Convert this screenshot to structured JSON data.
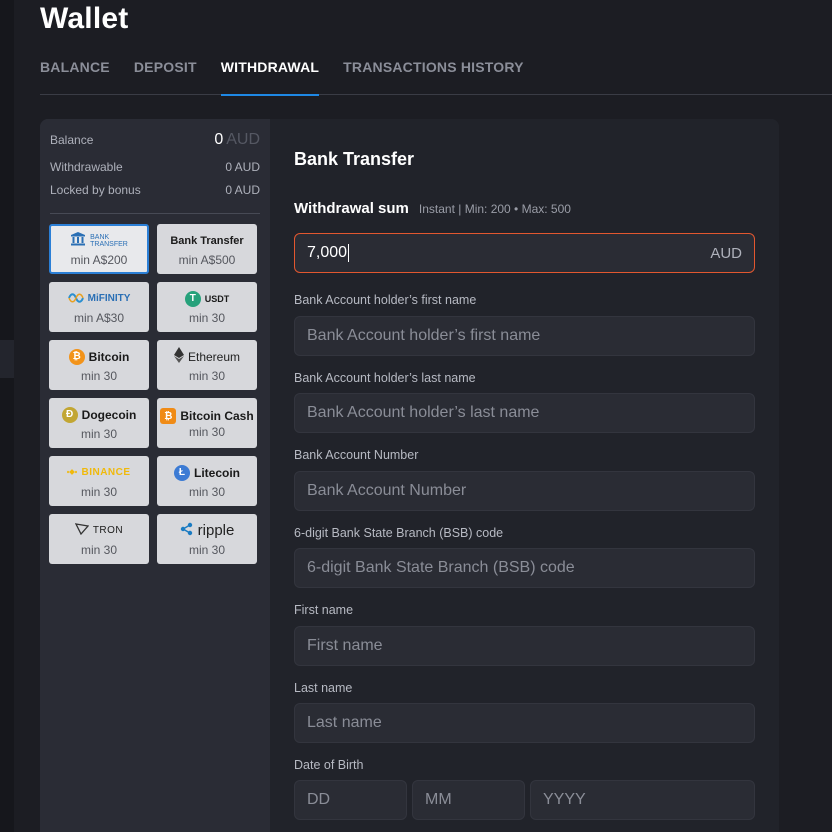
{
  "page": {
    "title": "Wallet"
  },
  "tabs": [
    {
      "label": "BALANCE"
    },
    {
      "label": "DEPOSIT"
    },
    {
      "label": "WITHDRAWAL",
      "active": true
    },
    {
      "label": "TRANSACTIONS HISTORY"
    }
  ],
  "balance": {
    "balance_label": "Balance",
    "balance_value": "0",
    "balance_currency": "AUD",
    "withdrawable_label": "Withdrawable",
    "withdrawable_value": "0 AUD",
    "locked_label": "Locked by bonus",
    "locked_value": "0 AUD"
  },
  "methods": [
    {
      "logo_top": "BANK",
      "logo_bottom": "TRANSFER",
      "min": "min A$200",
      "icon": "bank-icon"
    },
    {
      "logo": "Bank Transfer",
      "min": "min A$500"
    },
    {
      "logo": "MiFINITY",
      "min": "min A$30",
      "icon": "mifinity-icon"
    },
    {
      "logo": "USDT",
      "min": "min 30",
      "icon": "tether-icon"
    },
    {
      "logo": "Bitcoin",
      "min": "min 30",
      "icon": "bitcoin-icon"
    },
    {
      "logo": "Ethereum",
      "min": "min 30",
      "icon": "ethereum-icon"
    },
    {
      "logo": "Dogecoin",
      "min": "min 30",
      "icon": "dogecoin-icon"
    },
    {
      "logo": "Bitcoin Cash",
      "min": "min 30",
      "icon": "bitcoin-cash-icon"
    },
    {
      "logo": "BINANCE",
      "min": "min 30",
      "icon": "binance-icon"
    },
    {
      "logo": "Litecoin",
      "min": "min 30",
      "icon": "litecoin-icon"
    },
    {
      "logo": "TRON",
      "min": "min 30",
      "icon": "tron-icon"
    },
    {
      "logo": "ripple",
      "min": "min 30",
      "icon": "ripple-icon"
    }
  ],
  "form": {
    "heading": "Bank Transfer",
    "sum_label": "Withdrawal sum",
    "sum_hint": "Instant | Min: 200 • Max: 500",
    "amount_value": "7,000",
    "amount_currency": "AUD",
    "fields": [
      {
        "label": "Bank Account holder’s first name",
        "placeholder": "Bank Account holder’s first name"
      },
      {
        "label": "Bank Account holder’s last name",
        "placeholder": "Bank Account holder’s last name"
      },
      {
        "label": "Bank Account Number",
        "placeholder": "Bank Account Number"
      },
      {
        "label": "6-digit Bank State Branch (BSB) code",
        "placeholder": "6-digit Bank State Branch (BSB) code"
      },
      {
        "label": "First name",
        "placeholder": "First name"
      },
      {
        "label": "Last name",
        "placeholder": "Last name"
      }
    ],
    "dob": {
      "label": "Date of Birth",
      "day_placeholder": "DD",
      "month_placeholder": "MM",
      "year_placeholder": "YYYY"
    }
  },
  "colors": {
    "accent": "#1e88e5",
    "error_border": "#e2572f",
    "background": "#1c1d23",
    "panel": "#2a2c35"
  }
}
